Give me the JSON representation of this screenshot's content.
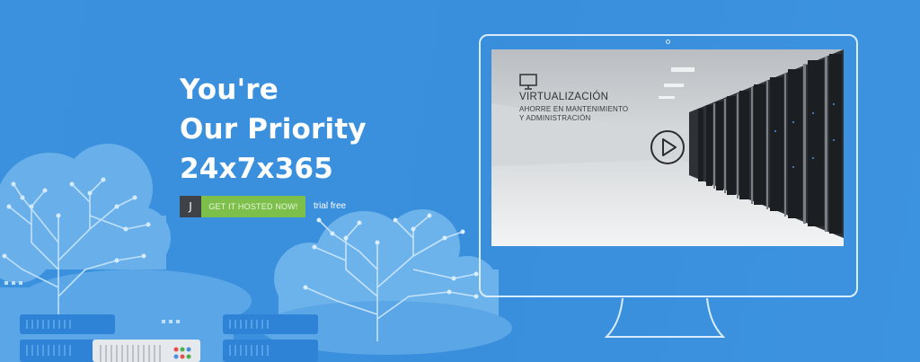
{
  "hero": {
    "headline": {
      "line1": "You're",
      "line2": "Our Priority",
      "line3": "24x7x365"
    },
    "cta": {
      "icon_letter": "J",
      "label": "GET IT HOSTED NOW!",
      "trial_text": "trial free"
    }
  },
  "monitor": {
    "screen": {
      "icon": "monitor-icon",
      "title": "VIRTUALIZACIÓN",
      "subtitle_line1": "AHORRE EN MANTENIMIENTO",
      "subtitle_line2": "Y ADMINISTRACIÓN",
      "play_icon": "play-icon"
    }
  },
  "colors": {
    "background": "#3a8fdc",
    "cta_green": "#7cc04b",
    "cta_dark": "#3f4347",
    "line_white": "#d9ecfb"
  }
}
